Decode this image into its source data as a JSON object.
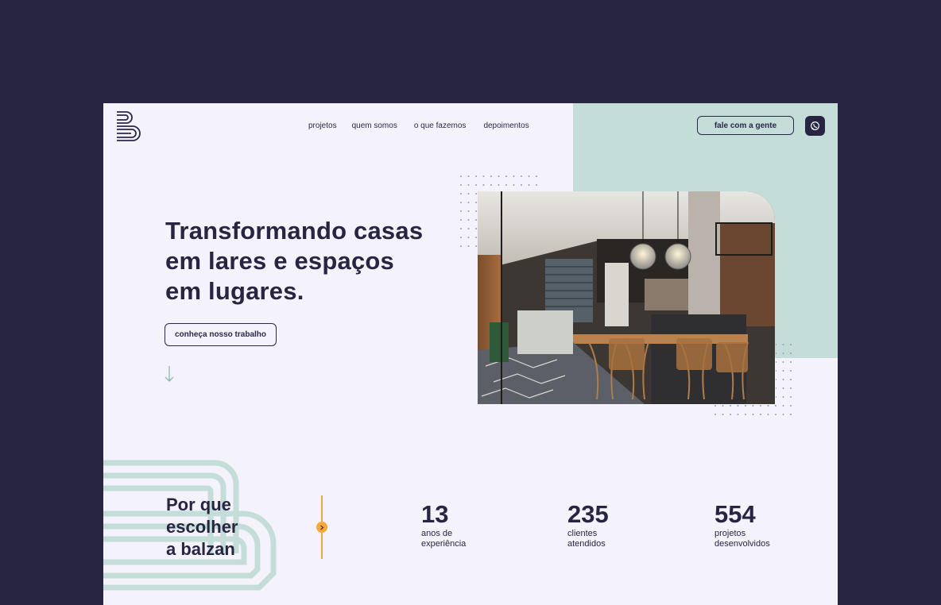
{
  "nav": {
    "items": [
      "projetos",
      "quem somos",
      "o que fazemos",
      "depoimentos"
    ],
    "cta_label": "fale com a gente"
  },
  "hero": {
    "title_line1": "Transformando casas",
    "title_line2": "em lares e espaços",
    "title_line3": "em lugares.",
    "cta_label": "conheça nosso trabalho"
  },
  "why": {
    "line1": "Por que",
    "line2": "escolher",
    "line3": "a balzan"
  },
  "stats": [
    {
      "value": "13",
      "label_line1": "anos de",
      "label_line2": "experiência"
    },
    {
      "value": "235",
      "label_line1": "clientes",
      "label_line2": "atendidos"
    },
    {
      "value": "554",
      "label_line1": "projetos",
      "label_line2": "desenvolvidos"
    }
  ],
  "colors": {
    "background": "#282542",
    "page": "#f4f3fc",
    "mint": "#c5ddd9",
    "accent": "#f6a83a",
    "text": "#282542"
  },
  "icons": {
    "logo": "balzan-b-logo",
    "whatsapp": "whatsapp-icon",
    "arrow": "arrow-down-icon",
    "divider": "chevron-right-icon"
  }
}
